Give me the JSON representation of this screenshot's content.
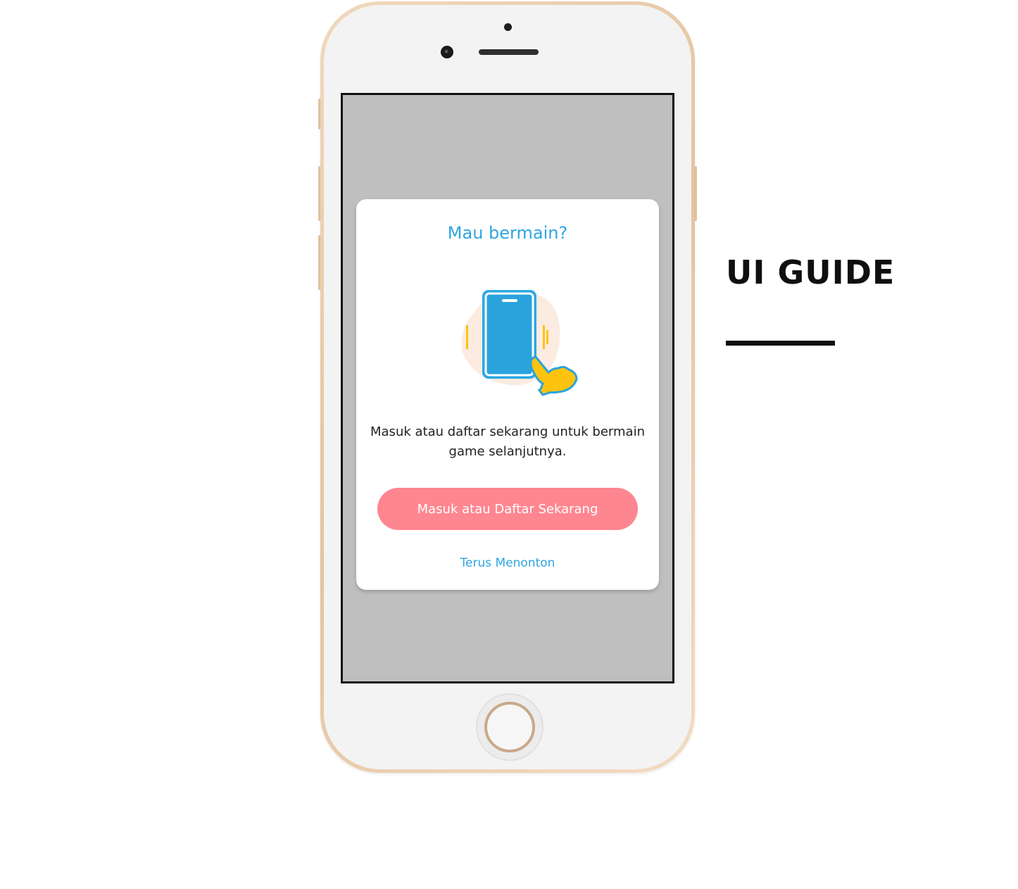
{
  "modal": {
    "title": "Mau bermain?",
    "illustration_icon": "tap-phone-icon",
    "message": "Masuk atau daftar sekarang untuk bermain game selanjutnya.",
    "primary_button_label": "Masuk atau Daftar Sekarang",
    "secondary_link_label": "Terus Menonton"
  },
  "side_panel": {
    "title": "UI GUIDE"
  },
  "colors": {
    "accent_blue": "#2fa5e2",
    "button_pink": "#fe8690",
    "overlay_gray": "#bfbfbf",
    "hand_yellow": "#fec30e",
    "phone_gold": "#e8c9a6"
  }
}
